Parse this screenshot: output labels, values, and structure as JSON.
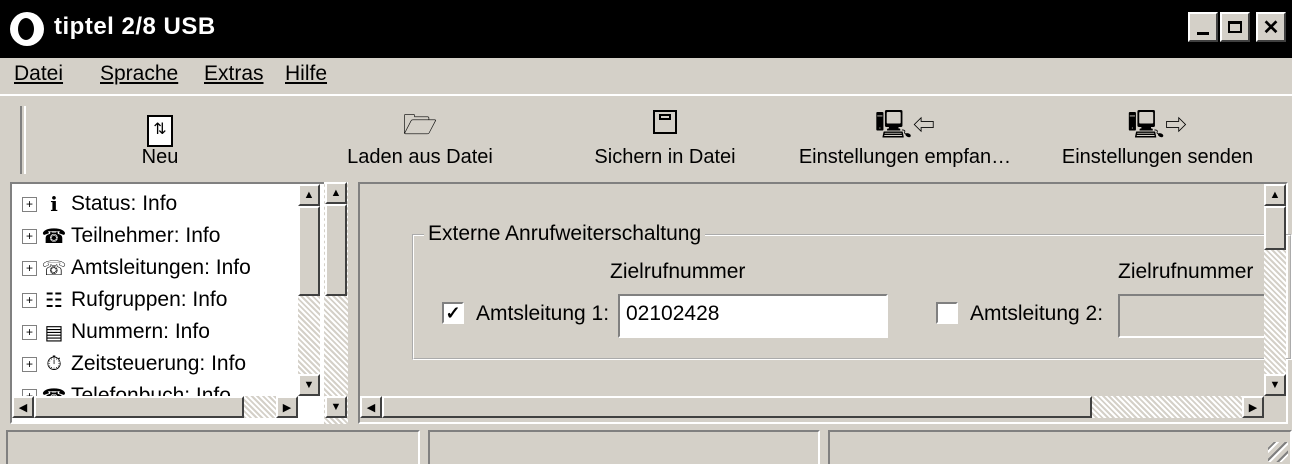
{
  "window": {
    "title": "tiptel 2/8 USB",
    "controls": [
      "minimize-icon",
      "maximize-icon",
      "close-icon"
    ]
  },
  "menu": {
    "items": [
      {
        "label": "Datei",
        "underline": "D"
      },
      {
        "label": "Sprache",
        "underline": "S"
      },
      {
        "label": "Extras",
        "underline": "E"
      },
      {
        "label": "Hilfe",
        "underline": "H"
      }
    ]
  },
  "toolbar": {
    "buttons": [
      {
        "label": "Neu",
        "icon": "new-document-icon"
      },
      {
        "label": "Laden aus Datei",
        "icon": "open-folder-icon"
      },
      {
        "label": "Sichern in Datei",
        "icon": "floppy-disk-icon"
      },
      {
        "label": "Einstellungen empfan…",
        "icon": "receive-settings-icon"
      },
      {
        "label": "Einstellungen senden",
        "icon": "send-settings-icon"
      }
    ]
  },
  "tree": {
    "items": [
      {
        "label": "Status: Info",
        "icon": "info-icon"
      },
      {
        "label": "Teilnehmer: Info",
        "icon": "telephone-icon"
      },
      {
        "label": "Amtsleitungen: Info",
        "icon": "line-icon"
      },
      {
        "label": "Rufgruppen: Info",
        "icon": "group-icon"
      },
      {
        "label": "Nummern: Info",
        "icon": "numbers-icon"
      },
      {
        "label": "Zeitsteuerung: Info",
        "icon": "timer-icon"
      },
      {
        "label": "Telefonbuch: Info",
        "icon": "phonebook-icon"
      }
    ]
  },
  "forwarding": {
    "group_title": "Externe Anrufweiterschaltung",
    "col1_header": "Zielrufnummer",
    "col2_header": "Zielrufnummer",
    "line1": {
      "label": "Amtsleitung 1:",
      "checked": true,
      "value": "02102428"
    },
    "line2": {
      "label": "Amtsleitung 2:",
      "checked": false,
      "value": ""
    }
  },
  "statusbar": {
    "cells": [
      "",
      "",
      ""
    ]
  }
}
